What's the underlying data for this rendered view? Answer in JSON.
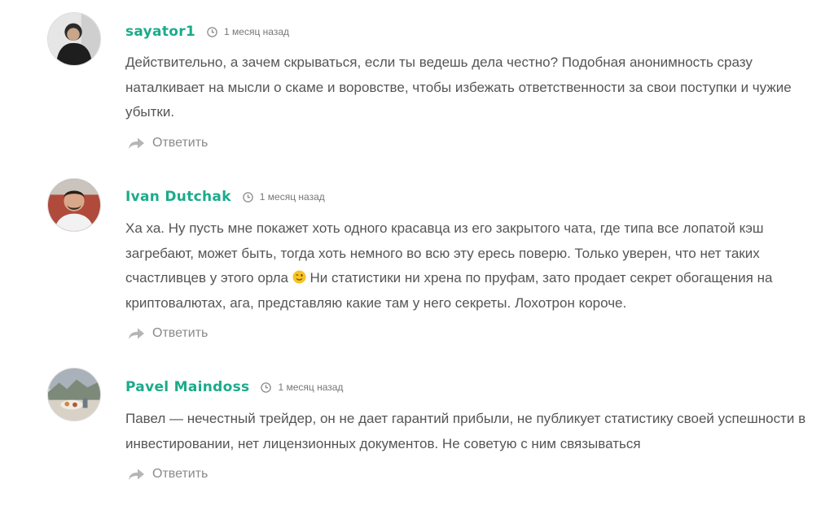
{
  "comments": [
    {
      "author": "sayator1",
      "time": "1 месяц назад",
      "text": "Действительно, а зачем скрываться, если ты ведешь дела честно? Подобная анонимность сразу наталкивает на мысли о скаме и воровстве, чтобы избежать ответственности за свои поступки и чужие убытки.",
      "reply_label": "Ответить"
    },
    {
      "author": "Ivan Dutchak",
      "time": "1 месяц назад",
      "text_before_emoji": "Ха ха. Ну пусть мне покажет хоть одного красавца из его закрытого чата, где типа все лопатой кэш загребают, может быть, тогда хоть немного во всю эту ересь поверю. Только уверен, что нет таких счастливцев у этого орла",
      "text_after_emoji": " Ни статистики ни хрена по пруфам, зато продает секрет обогащения на криптовалютах, ага, представляю какие там у него секреты. Лохотрон короче.",
      "emoji": "winking-face",
      "reply_label": "Ответить"
    },
    {
      "author": "Pavel Maindoss",
      "time": "1 месяц назад",
      "text": "Павел — нечестный трейдер, он не дает гарантий прибыли, не публикует статистику своей успешности в инвестировании, нет лицензионных документов. Не советую с ним связываться",
      "reply_label": "Ответить"
    }
  ],
  "colors": {
    "author": "#1bab8a",
    "text": "#555555",
    "meta": "#777777",
    "reply_icon": "#b5b5b5"
  },
  "icons": {
    "time": "clock-icon",
    "reply": "reply-arrow-icon"
  }
}
